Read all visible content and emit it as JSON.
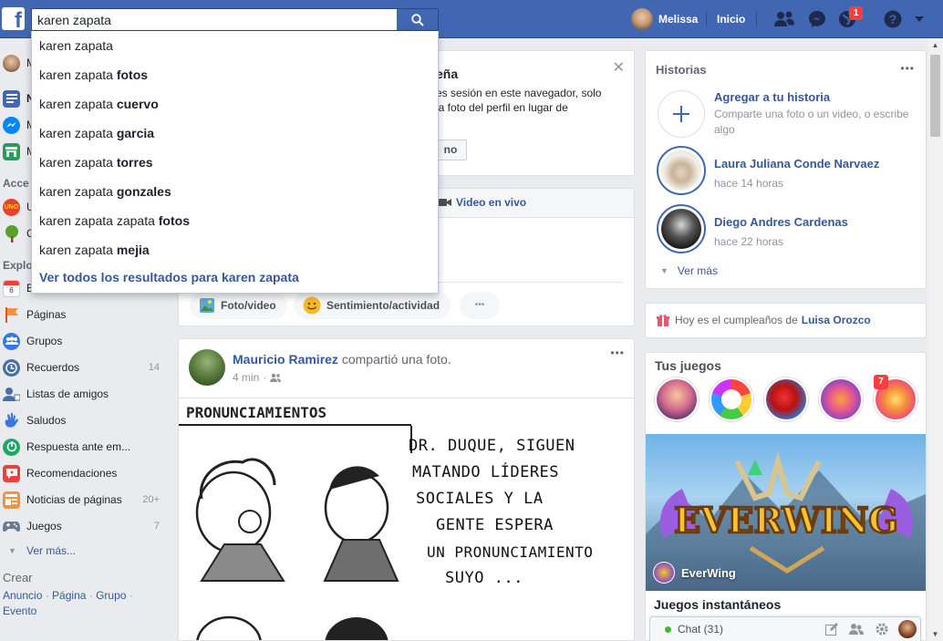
{
  "topbar": {
    "search_value": "karen zapata",
    "user_name": "Melissa",
    "home_label": "Inicio",
    "notif_count": "1"
  },
  "search_suggestions": [
    {
      "base": "karen zapata",
      "bold": ""
    },
    {
      "base": "karen zapata",
      "bold": "fotos"
    },
    {
      "base": "karen zapata",
      "bold": "cuervo"
    },
    {
      "base": "karen zapata",
      "bold": "garcia"
    },
    {
      "base": "karen zapata",
      "bold": "torres"
    },
    {
      "base": "karen zapata",
      "bold": "gonzales"
    },
    {
      "base": "karen zapata zapata",
      "bold": "fotos"
    },
    {
      "base": "karen zapata",
      "bold": "mejia"
    }
  ],
  "search_see_all": "Ver todos los resultados para karen zapata",
  "leftnav": {
    "partial_top": [
      "M",
      "N",
      "M",
      "M"
    ],
    "acceso_head": "Acce",
    "acceso_items": [
      "U",
      "C"
    ],
    "explorar_head": "Explo",
    "explorar_first": "E",
    "items": [
      {
        "label": "Páginas",
        "count": ""
      },
      {
        "label": "Grupos",
        "count": ""
      },
      {
        "label": "Recuerdos",
        "count": "14"
      },
      {
        "label": "Listas de amigos",
        "count": ""
      },
      {
        "label": "Saludos",
        "count": ""
      },
      {
        "label": "Respuesta ante em...",
        "count": ""
      },
      {
        "label": "Recomendaciones",
        "count": ""
      },
      {
        "label": "Noticias de páginas",
        "count": "20+"
      },
      {
        "label": "Juegos",
        "count": "7"
      }
    ],
    "see_more": "Ver más...",
    "crear_head": "Crear",
    "crear_links": [
      "Anuncio",
      "Página",
      "Grupo",
      "Evento"
    ]
  },
  "compose_note": {
    "title_fragment": "eña",
    "line1": "es sesión en este navegador, solo",
    "line2": "la foto del perfil en lugar de",
    "button_fragment": "no"
  },
  "compose": {
    "live_video": "Video en vivo",
    "photo_video": "Foto/video",
    "feeling": "Sentimiento/actividad",
    "more": "•••"
  },
  "post": {
    "author": "Mauricio Ramirez",
    "action": "compartió una foto.",
    "time": "4 min",
    "comic_title": "PRONUNCIAMIENTOS",
    "comic_text": [
      "DR. DUQUE, SIGUEN",
      "MATANDO LÍDERES",
      "SOCIALES Y LA",
      "GENTE ESPERA",
      "UN PRONUNCIAMIENTO",
      "SUYO ..."
    ]
  },
  "stories": {
    "title": "Historias",
    "add_title": "Agregar a tu historia",
    "add_sub": "Comparte una foto o un video, o escribe algo",
    "items": [
      {
        "name": "Laura Juliana Conde Narvaez",
        "time": "hace 14 horas"
      },
      {
        "name": "Diego Andres Cardenas",
        "time": "hace 22 horas"
      }
    ],
    "see_more": "Ver más"
  },
  "birthday": {
    "prefix": "Hoy es el cumpleaños de",
    "name": "Luisa Orozco"
  },
  "games": {
    "title": "Tus juegos",
    "badge": "7",
    "featured_title": "EverWing",
    "featured_art": "EVERWING",
    "instant_title": "Juegos instantáneos"
  },
  "chat": {
    "label": "Chat (31)"
  },
  "colors": {
    "brand": "#4267b2",
    "link": "#365899",
    "online": "#42b72a"
  }
}
